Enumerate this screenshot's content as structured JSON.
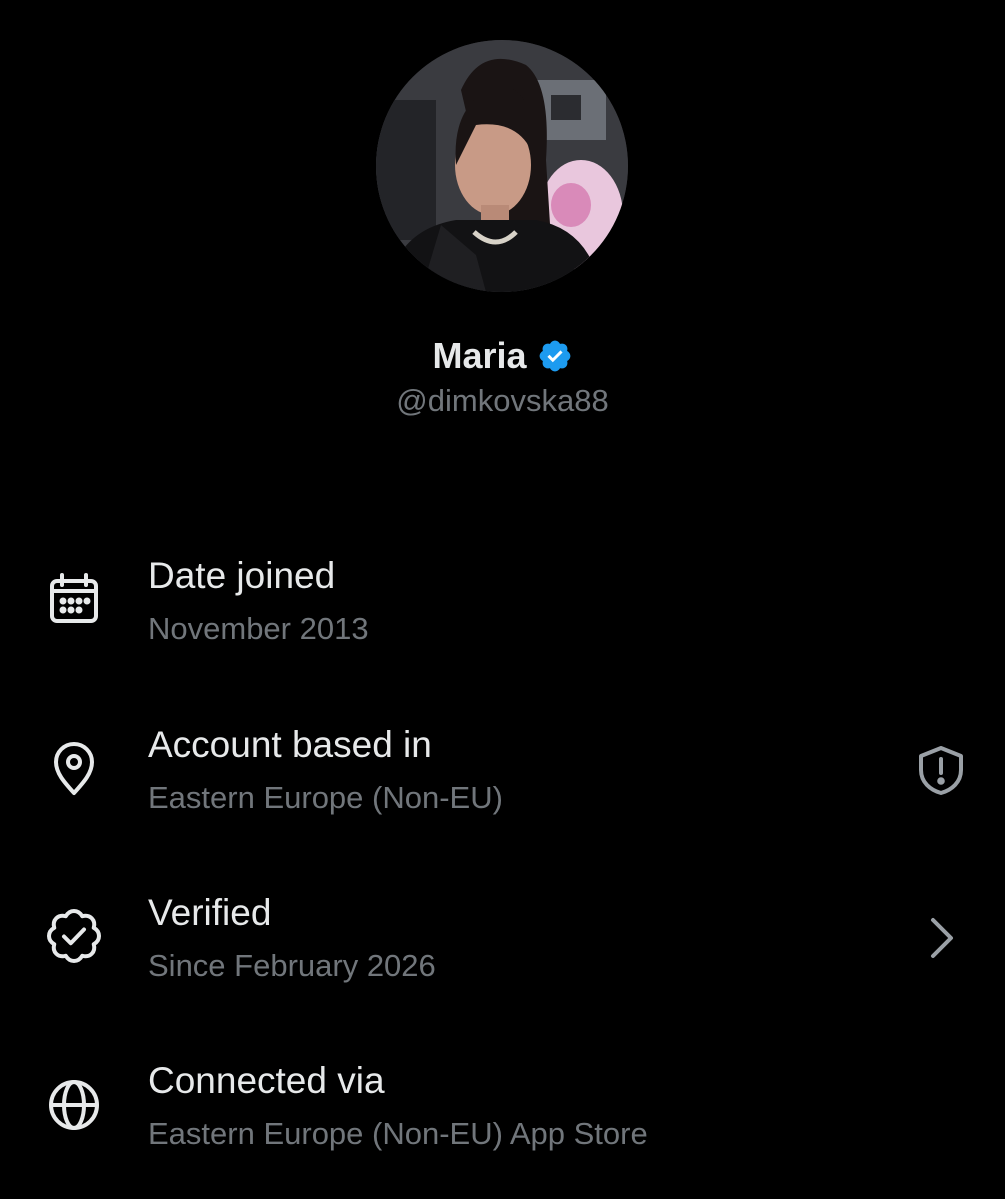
{
  "profile": {
    "display_name": "Maria",
    "handle": "@dimkovska88",
    "verified": true,
    "verified_badge_color": "#1d9bf0"
  },
  "details": [
    {
      "icon": "calendar-icon",
      "title": "Date joined",
      "subtitle": "November 2013"
    },
    {
      "icon": "location-pin-icon",
      "title": "Account based in",
      "subtitle": "Eastern Europe (Non-EU)",
      "trailing_icon": "shield-alert-icon"
    },
    {
      "icon": "verified-seal-icon",
      "title": "Verified",
      "subtitle": "Since February 2026",
      "trailing_icon": "chevron-right-icon"
    },
    {
      "icon": "globe-icon",
      "title": "Connected via",
      "subtitle": "Eastern Europe (Non-EU) App Store"
    }
  ],
  "colors": {
    "background": "#000000",
    "primary_text": "#e7e9ea",
    "secondary_text": "#71767b",
    "accent": "#1d9bf0"
  }
}
